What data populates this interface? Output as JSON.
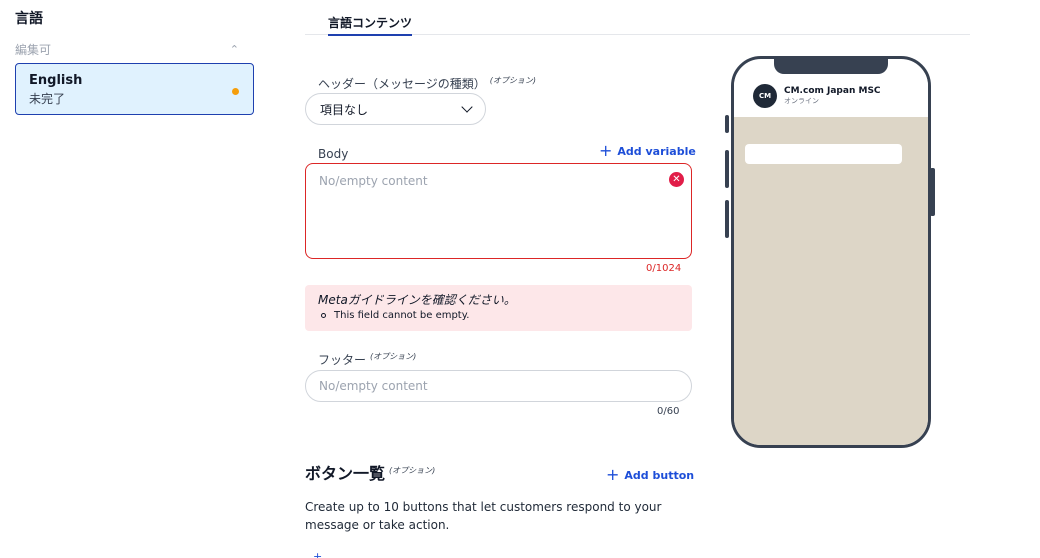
{
  "sidebar": {
    "title": "言語",
    "section_label": "編集可",
    "languages": [
      {
        "name": "English",
        "status": "未完了"
      }
    ],
    "status_dot_color": "#f59e0b"
  },
  "tabs": [
    {
      "label": "言語コンテンツ",
      "active": true
    }
  ],
  "form": {
    "header": {
      "label": "ヘッダー（メッセージの種類）",
      "optional": "(オプション)",
      "value": "項目なし"
    },
    "body": {
      "label": "Body",
      "add_variable": "Add variable",
      "placeholder": "No/empty content",
      "counter": "0/1024"
    },
    "alert": {
      "title": "Metaガイドラインを確認ください。",
      "items": [
        "This field cannot be empty."
      ]
    },
    "footer": {
      "label": "フッター",
      "optional": "(オプション)",
      "placeholder": "No/empty content",
      "counter": "0/60"
    },
    "buttons": {
      "heading": "ボタン一覧",
      "optional": "(オプション)",
      "add_button": "Add button",
      "description": "Create up to 10 buttons that let customers respond to your message or take action."
    }
  },
  "preview": {
    "avatar_text": "CM",
    "account_name": "CM.com Japan MSC",
    "account_status": "オンライン"
  },
  "colors": {
    "accent": "#1d4ed8",
    "error": "#dc2626",
    "alert_bg": "#fde7e9",
    "chat_bg": "#ddd6c7"
  }
}
